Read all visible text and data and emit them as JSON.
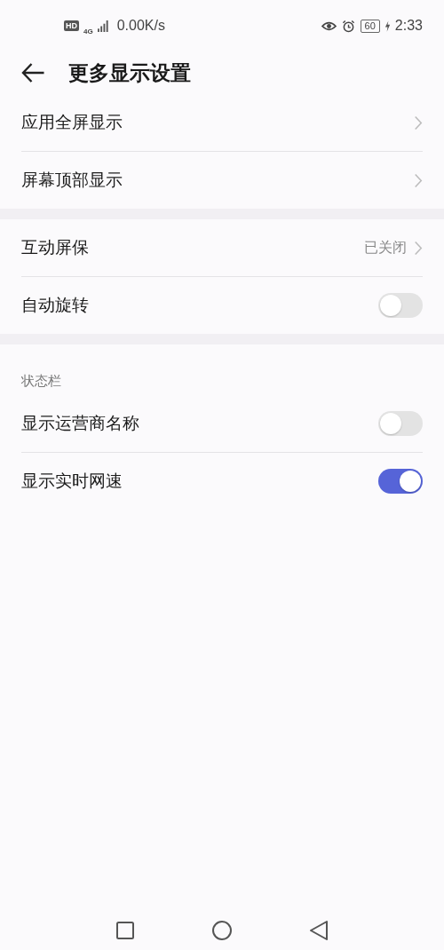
{
  "status_bar": {
    "hd": "HD",
    "network": "4G",
    "speed": "0.00K/s",
    "battery": "60",
    "time": "2:33"
  },
  "header": {
    "title": "更多显示设置"
  },
  "groups": [
    {
      "items": [
        {
          "kind": "link",
          "label": "应用全屏显示"
        },
        {
          "kind": "link",
          "label": "屏幕顶部显示"
        }
      ]
    },
    {
      "items": [
        {
          "kind": "link",
          "label": "互动屏保",
          "value": "已关闭"
        },
        {
          "kind": "toggle",
          "label": "自动旋转",
          "on": false
        }
      ]
    },
    {
      "title": "状态栏",
      "items": [
        {
          "kind": "toggle",
          "label": "显示运营商名称",
          "on": false
        },
        {
          "kind": "toggle",
          "label": "显示实时网速",
          "on": true
        }
      ]
    }
  ]
}
